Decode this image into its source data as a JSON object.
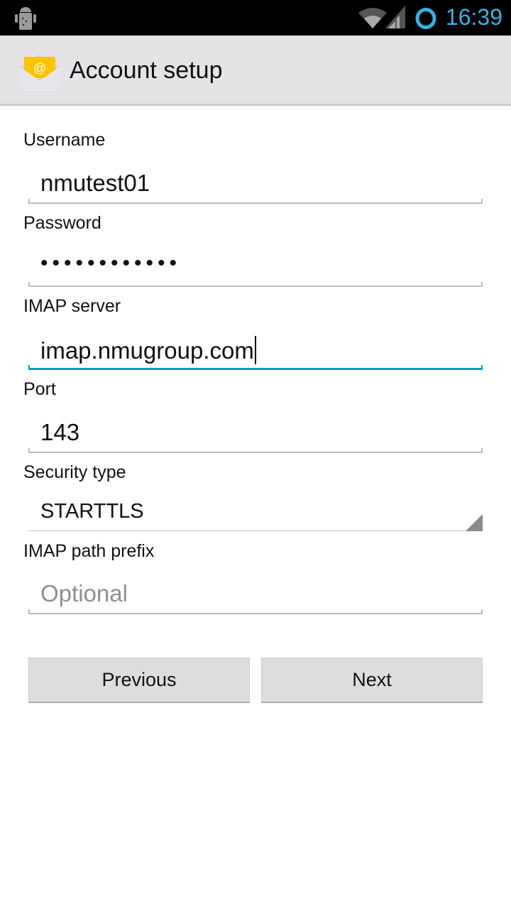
{
  "status_bar": {
    "time": "16:39",
    "icons": [
      "android-debug-icon",
      "wifi-icon",
      "signal-icon",
      "sync-circle-icon"
    ],
    "accent": "#33b5e5"
  },
  "action_bar": {
    "title": "Account setup",
    "icon": "email-app-icon"
  },
  "form": {
    "username": {
      "label": "Username",
      "value": "nmutest01"
    },
    "password": {
      "label": "Password",
      "value": "••••••••••••"
    },
    "imap_server": {
      "label": "IMAP server",
      "value": "imap.nmugroup.com"
    },
    "port": {
      "label": "Port",
      "value": "143"
    },
    "security_type": {
      "label": "Security type",
      "value": "STARTTLS"
    },
    "imap_path_prefix": {
      "label": "IMAP path prefix",
      "placeholder": "Optional"
    }
  },
  "buttons": {
    "previous": "Previous",
    "next": "Next"
  }
}
